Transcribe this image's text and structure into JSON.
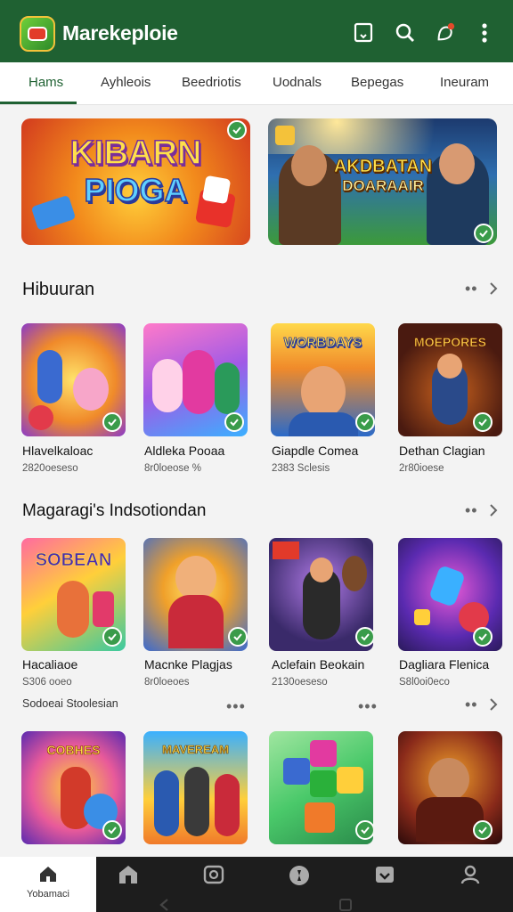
{
  "app": {
    "title": "Marekeploie",
    "brand_color": "#1f6132",
    "icons": [
      "cast-icon",
      "search-icon",
      "notification-icon",
      "more-vert-icon"
    ]
  },
  "tabs": [
    {
      "label": "Hams",
      "active": true
    },
    {
      "label": "Ayhleois",
      "active": false
    },
    {
      "label": "Beedriotis",
      "active": false
    },
    {
      "label": "Uodnals",
      "active": false
    },
    {
      "label": "Bepegas",
      "active": false
    },
    {
      "label": "Ineuram",
      "active": false
    }
  ],
  "banners": [
    {
      "title_line1": "KIBARN",
      "title_line2": "PIOGA"
    },
    {
      "title_line1": "AKDBATAN",
      "title_line2": "DOARAAIR"
    }
  ],
  "sections": [
    {
      "title": "Hibuuran",
      "items": [
        {
          "art_text": "",
          "name": "Hlavelkaloac",
          "meta": "2820oeseso"
        },
        {
          "art_text": "",
          "name": "Aldleka Pooaa",
          "meta": "8r0loeose %"
        },
        {
          "art_text": "WORBDAYS",
          "name": "Giapdle Comea",
          "meta": "2383 Sclesis"
        },
        {
          "art_text": "MOEPORES",
          "name": "Dethan Clagian",
          "meta": "2r80ioese"
        }
      ]
    },
    {
      "title": "Magaragi's Indsotiondan",
      "subline": "Sodoeai Stoolesian",
      "items": [
        {
          "art_text": "SOBEAN",
          "name": "Hacaliaoe",
          "meta": "S306 ooeo"
        },
        {
          "art_text": "",
          "name": "Macnke Plagjas",
          "meta": "8r0loeoes"
        },
        {
          "art_text": "",
          "name": "Aclefain Beokain",
          "meta": "2130oeseso"
        },
        {
          "art_text": "",
          "name": "Dagliara Flenica",
          "meta": "S8l0oi0eco"
        }
      ]
    },
    {
      "title": "",
      "items": [
        {
          "art_text": "COBHES"
        },
        {
          "art_text": "MAVEREAM"
        },
        {
          "art_text": ""
        },
        {
          "art_text": ""
        }
      ]
    }
  ],
  "bottom_nav": [
    {
      "icon": "home-icon",
      "label": "Yobamaci",
      "active": true
    },
    {
      "icon": "store-icon",
      "label": "",
      "active": false
    },
    {
      "icon": "games-icon",
      "label": "",
      "active": false
    },
    {
      "icon": "compass-icon",
      "label": "",
      "active": false
    },
    {
      "icon": "wallet-icon",
      "label": "",
      "active": false
    },
    {
      "icon": "profile-icon",
      "label": "",
      "active": false
    }
  ]
}
